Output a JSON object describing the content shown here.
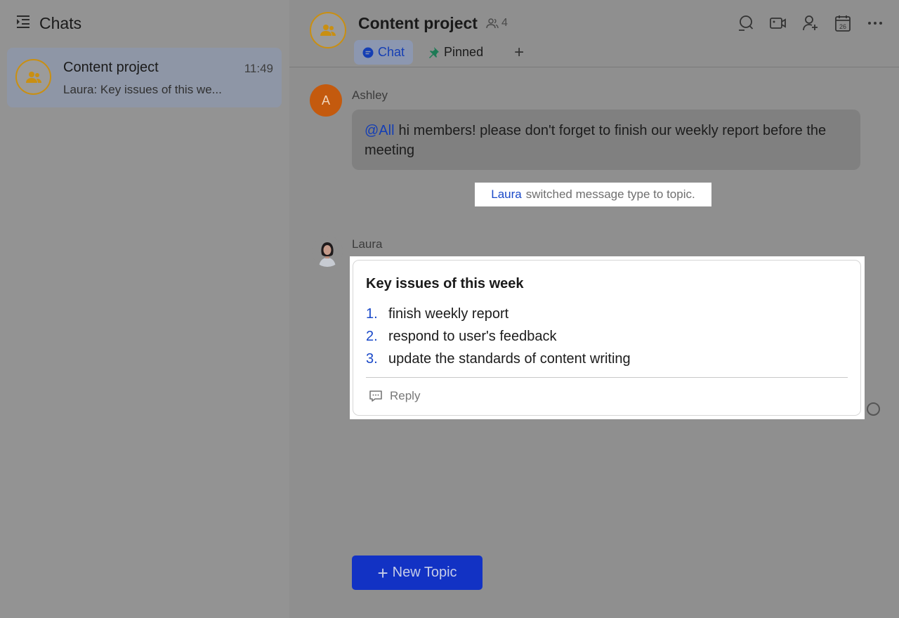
{
  "sidebar": {
    "title": "Chats",
    "chats": [
      {
        "name": "Content project",
        "time": "11:49",
        "preview": "Laura: Key issues of this we..."
      }
    ]
  },
  "header": {
    "title": "Content project",
    "member_count": "4",
    "tabs": [
      {
        "label": "Chat",
        "active": true
      },
      {
        "label": "Pinned",
        "active": false
      }
    ],
    "add_tab_label": "+"
  },
  "messages": {
    "first": {
      "sender": "Ashley",
      "avatar_letter": "A",
      "mention": "@All",
      "text": "hi members! please don't forget to finish our weekly report before the meeting"
    },
    "system": {
      "actor": "Laura",
      "text": "switched message type to topic."
    },
    "topic": {
      "sender": "Laura",
      "title": "Key issues of this week",
      "items": [
        {
          "num": "1.",
          "text": "finish weekly report"
        },
        {
          "num": "2.",
          "text": "respond to user's feedback"
        },
        {
          "num": "3.",
          "text": "update the standards of content writing"
        }
      ],
      "reply_label": "Reply"
    }
  },
  "footer": {
    "new_topic_label": "New Topic",
    "new_topic_plus": "+"
  },
  "colors": {
    "accent": "#1232c4",
    "mention": "#143eb4",
    "group_ring": "#c98f12",
    "avatar_a": "#c45a0e"
  },
  "icons": [
    "sidebar-toggle-icon",
    "group-icon",
    "members-icon",
    "chat-bubble-icon",
    "pin-icon",
    "search-icon",
    "video-call-icon",
    "add-member-icon",
    "calendar-icon",
    "more-icon",
    "reply-icon"
  ],
  "calendar_day": "26"
}
